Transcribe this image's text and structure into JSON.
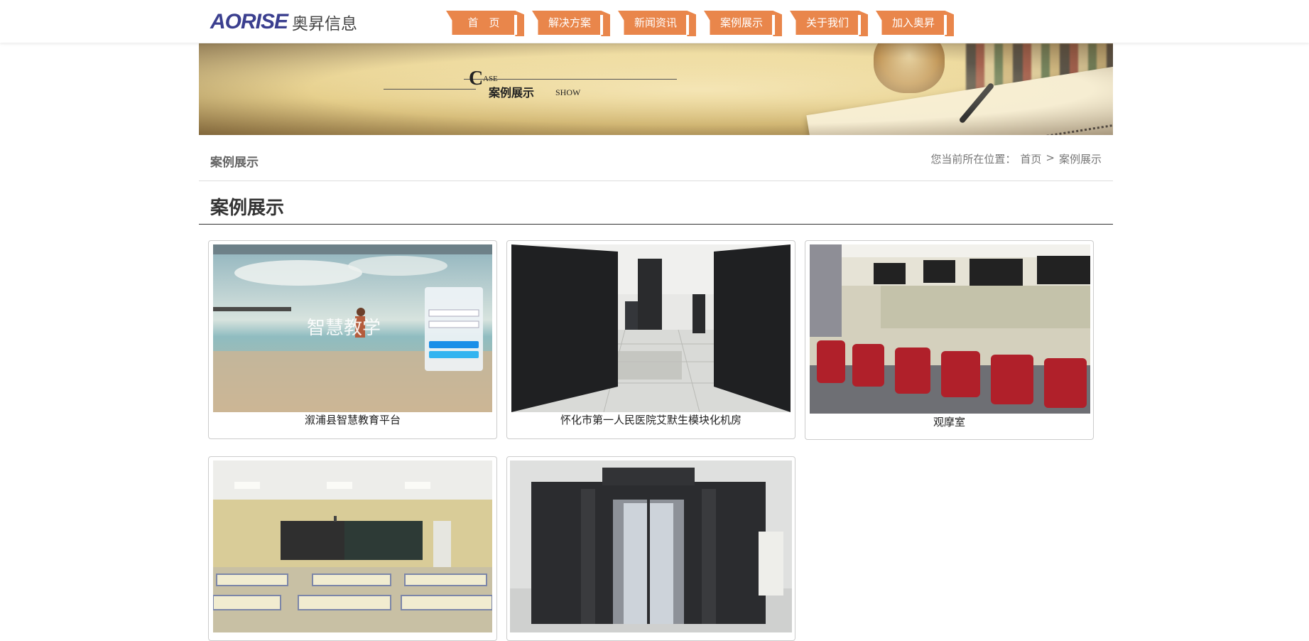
{
  "header": {
    "logo_en": "AORISE",
    "logo_cn": "奥昇信息",
    "nav": [
      {
        "label": "首　页"
      },
      {
        "label": "解决方案"
      },
      {
        "label": "新闻资讯"
      },
      {
        "label": "案例展示"
      },
      {
        "label": "关于我们"
      },
      {
        "label": "加入奥昇"
      }
    ]
  },
  "banner": {
    "en_big": "C",
    "en_rest": "ASE",
    "cn": "案例展示",
    "en_show": "SHOW"
  },
  "crumb": {
    "title": "案例展示",
    "prefix": "您当前所在位置：",
    "home": "首页",
    "sep": ">",
    "current": "案例展示"
  },
  "section": {
    "title": "案例展示"
  },
  "cases": [
    {
      "caption": "溆浦县智慧教育平台",
      "overlay_title": "智慧教学"
    },
    {
      "caption": "怀化市第一人民医院艾默生模块化机房"
    },
    {
      "caption": "观摩室"
    },
    {
      "caption": ""
    },
    {
      "caption": ""
    }
  ],
  "colors": {
    "nav_bg": "#e9864b",
    "logo_blue": "#3b3f8f"
  }
}
